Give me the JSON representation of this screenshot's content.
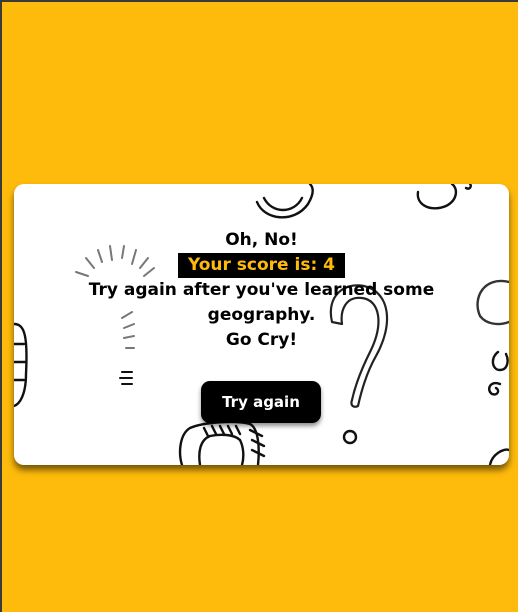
{
  "result": {
    "heading": "Oh, No!",
    "score_text": "Your score is: 4",
    "message": "Try again after you've learned some geography.",
    "sub_message": "Go Cry!",
    "retry_label": "Try again"
  },
  "colors": {
    "background": "#ffbb0c",
    "card": "#ffffff",
    "score_text": "#ffbb0c",
    "button": "#000000"
  },
  "decorations": {
    "icon": "question-mark-doodles-icon"
  }
}
